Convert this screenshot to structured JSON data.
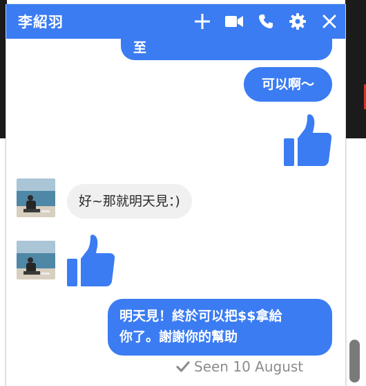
{
  "window": {
    "title": "李紹羽",
    "header_icons": [
      "plus-icon",
      "video-call-icon",
      "phone-icon",
      "gear-icon",
      "close-icon"
    ],
    "accent_color": "#3b7cf2"
  },
  "messages": [
    {
      "sender": "me",
      "type": "text",
      "text": "至"
    },
    {
      "sender": "me",
      "type": "text",
      "text": "可以啊～"
    },
    {
      "sender": "me",
      "type": "like",
      "icon": "thumbs-up-icon"
    },
    {
      "sender": "other",
      "type": "text",
      "text": "好~那就明天見：)"
    },
    {
      "sender": "other",
      "type": "like",
      "icon": "thumbs-up-icon"
    },
    {
      "sender": "me",
      "type": "text",
      "lines": [
        "明天見！終於可以把$$拿給",
        "你了。謝謝你的幫助"
      ]
    }
  ],
  "status": {
    "seen_text": "Seen 10 August",
    "icon": "checkmark-icon"
  }
}
